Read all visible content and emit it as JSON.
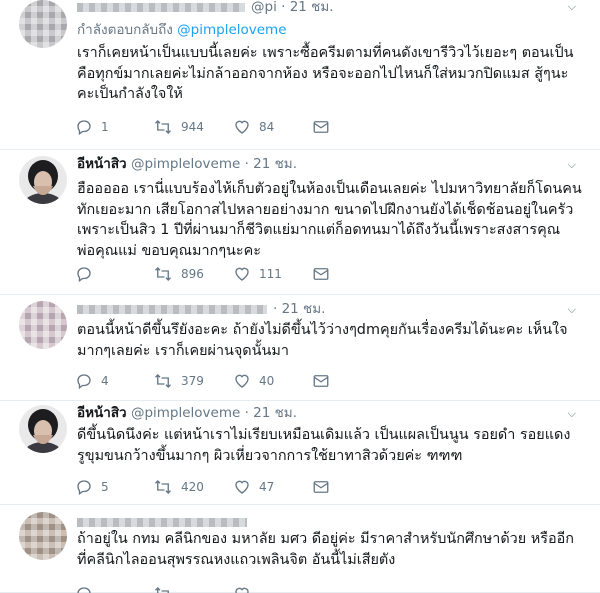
{
  "tweets": [
    {
      "name": "",
      "handle": "@pi",
      "time": "· 21 ชม.",
      "reply_label": "กำลังตอบกลับถึง",
      "reply_mention": "@pimpleloveme",
      "text": "เราก็เคยหน้าเป็นแบบนี้เลยค่ะ เพราะซื้อครีมตามที่คนดังเขารีวิวไว้เยอะๆ ตอนเป็นคือทุกข์มากเลยค่ะไม่กล้าออกจากห้อง หรือจะออกไปไหนก็ใส่หมวกปิดแมส สู้ๆนะคะเป็นกำลังใจให้",
      "replies": "1",
      "retweets": "944",
      "likes": "84"
    },
    {
      "name": "อีหน้าสิว",
      "handle": "@pimpleloveme",
      "time": "· 21 ชม.",
      "text": "ฮือออออ เรานี่แบบร้องไห้เก็บตัวอยู่ในห้องเป็นเดือนเลยค่ะ ไปมหาวิทยาลัยก็โดนคนทักเยอะมาก เสียโอกาสไปหลายอย่างมาก ขนาดไปฝึกงานยังได้เช็ดช้อนอยู่ในครัวเพราะเป็นสิว 1 ปีที่ผ่านมาก็ชีวิตแย่มากแต่ก็อดทนมาได้ถึงวันนี้เพราะสงสารคุณพ่อคุณแม่ ขอบคุณมากๆนะคะ",
      "replies": "",
      "retweets": "896",
      "likes": "111"
    },
    {
      "name": "",
      "handle": "",
      "time": "· 21 ชม.",
      "text": "ตอนนี้หน้าดีขึ้นรึยังอะคะ ถ้ายังไม่ดีขึ้นไว้ว่างๆdmคุยกันเรื่องครีมได้นะคะ เห็นใจมากๆเลยค่ะ เราก็เคยผ่านจุดนั้นมา",
      "replies": "4",
      "retweets": "379",
      "likes": "40"
    },
    {
      "name": "อีหน้าสิว",
      "handle": "@pimpleloveme",
      "time": "· 21 ชม.",
      "text": "ดีขึ้นนิดนึงค่ะ แต่หน้าเราไม่เรียบเหมือนเดิมแล้ว เป็นแผลเป็นนูน รอยดำ รอยแดง รูขุมขนกว้างขึ้นมากๆ ผิวเหี่ยวจากการใช้ยาทาสิวด้วยค่ะ ฑฑฑ",
      "replies": "5",
      "retweets": "420",
      "likes": "47"
    },
    {
      "name": "",
      "handle": "",
      "time": "",
      "text": "ถ้าอยู่ใน กทม คลีนิกของ มหาลัย มศว ดีอยู่ค่ะ มีราคาสำหรับนักศึกษาด้วย หรืออีกที่คลีนิกไลออนสุพรรณหงแถวเพลินจิต อันนี้ไม่เสียตัง",
      "replies": "",
      "retweets": "",
      "likes": ""
    }
  ],
  "icons": {
    "reply": "reply-icon",
    "retweet": "retweet-icon",
    "like": "heart-icon",
    "dm": "envelope-icon",
    "caret": "chevron-down-icon"
  },
  "colors": {
    "link": "#1da1f2",
    "muted": "#657786",
    "text": "#14171a",
    "divider": "#e6ecf0"
  }
}
